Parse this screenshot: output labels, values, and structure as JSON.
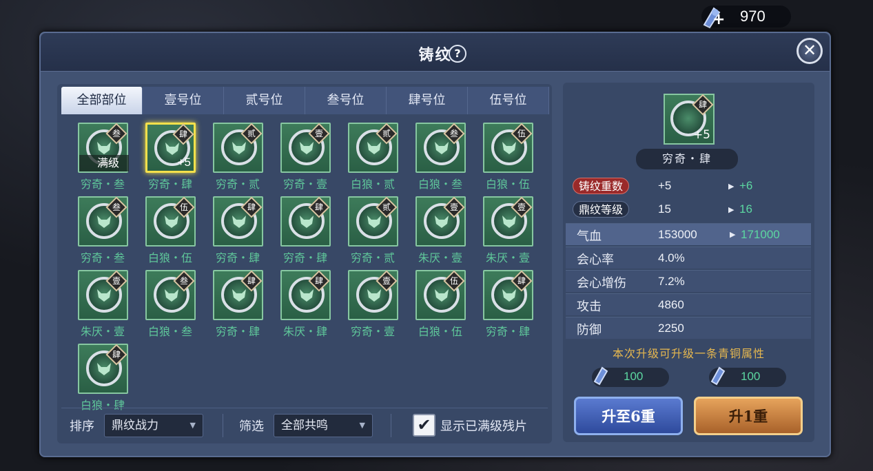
{
  "currency": {
    "value": "970",
    "plus": "+"
  },
  "modal": {
    "title": "铸纹",
    "help": "?",
    "close": "✕"
  },
  "tabs": [
    "全部部位",
    "壹号位",
    "贰号位",
    "叁号位",
    "肆号位",
    "伍号位"
  ],
  "items": [
    {
      "name": "穷奇・叁",
      "badge": "叁",
      "level_label": "满级",
      "plus": "",
      "selected": false
    },
    {
      "name": "穷奇・肆",
      "badge": "肆",
      "level_label": "",
      "plus": "+5",
      "selected": true
    },
    {
      "name": "穷奇・贰",
      "badge": "贰",
      "level_label": "",
      "plus": "",
      "selected": false
    },
    {
      "name": "穷奇・壹",
      "badge": "壹",
      "level_label": "",
      "plus": "",
      "selected": false
    },
    {
      "name": "白狼・贰",
      "badge": "贰",
      "level_label": "",
      "plus": "",
      "selected": false
    },
    {
      "name": "白狼・叁",
      "badge": "叁",
      "level_label": "",
      "plus": "",
      "selected": false
    },
    {
      "name": "白狼・伍",
      "badge": "伍",
      "level_label": "",
      "plus": "",
      "selected": false
    },
    {
      "name": "穷奇・叁",
      "badge": "叁",
      "level_label": "",
      "plus": "",
      "selected": false
    },
    {
      "name": "白狼・伍",
      "badge": "伍",
      "level_label": "",
      "plus": "",
      "selected": false
    },
    {
      "name": "穷奇・肆",
      "badge": "肆",
      "level_label": "",
      "plus": "",
      "selected": false
    },
    {
      "name": "穷奇・肆",
      "badge": "肆",
      "level_label": "",
      "plus": "",
      "selected": false
    },
    {
      "name": "穷奇・贰",
      "badge": "贰",
      "level_label": "",
      "plus": "",
      "selected": false
    },
    {
      "name": "朱厌・壹",
      "badge": "壹",
      "level_label": "",
      "plus": "",
      "selected": false
    },
    {
      "name": "朱厌・壹",
      "badge": "壹",
      "level_label": "",
      "plus": "",
      "selected": false
    },
    {
      "name": "朱厌・壹",
      "badge": "壹",
      "level_label": "",
      "plus": "",
      "selected": false
    },
    {
      "name": "白狼・叁",
      "badge": "叁",
      "level_label": "",
      "plus": "",
      "selected": false
    },
    {
      "name": "穷奇・肆",
      "badge": "肆",
      "level_label": "",
      "plus": "",
      "selected": false
    },
    {
      "name": "朱厌・肆",
      "badge": "肆",
      "level_label": "",
      "plus": "",
      "selected": false
    },
    {
      "name": "穷奇・壹",
      "badge": "壹",
      "level_label": "",
      "plus": "",
      "selected": false
    },
    {
      "name": "白狼・伍",
      "badge": "伍",
      "level_label": "",
      "plus": "",
      "selected": false
    },
    {
      "name": "穷奇・肆",
      "badge": "肆",
      "level_label": "",
      "plus": "",
      "selected": false
    },
    {
      "name": "白狼・肆",
      "badge": "肆",
      "level_label": "",
      "plus": "",
      "selected": false
    }
  ],
  "bottom": {
    "sort_label": "排序",
    "sort_value": "鼎纹战力",
    "filter_label": "筛选",
    "filter_value": "全部共鸣",
    "show_maxed_label": "显示已满级残片",
    "show_maxed_checked": true
  },
  "detail": {
    "badge": "肆",
    "plus": "+5",
    "name": "穷奇・肆",
    "forge_label": "铸纹重数",
    "forge_cur": "+5",
    "forge_next": "+6",
    "ding_label": "鼎纹等级",
    "ding_cur": "15",
    "ding_next": "16",
    "stats": [
      {
        "name": "气血",
        "value": "153000",
        "next": "171000"
      },
      {
        "name": "会心率",
        "value": "4.0%",
        "next": ""
      },
      {
        "name": "会心增伤",
        "value": "7.2%",
        "next": ""
      },
      {
        "name": "攻击",
        "value": "4860",
        "next": ""
      },
      {
        "name": "防御",
        "value": "2250",
        "next": ""
      }
    ],
    "note": "本次升级可升级一条青铜属性",
    "cost1": "100",
    "cost2": "100",
    "btn_max": "升至6重",
    "btn_one": "升1重"
  },
  "colors": {
    "accent_green": "#5cd7a1",
    "note_gold": "#e7b84f",
    "tile_green": "#3d7b5a"
  }
}
